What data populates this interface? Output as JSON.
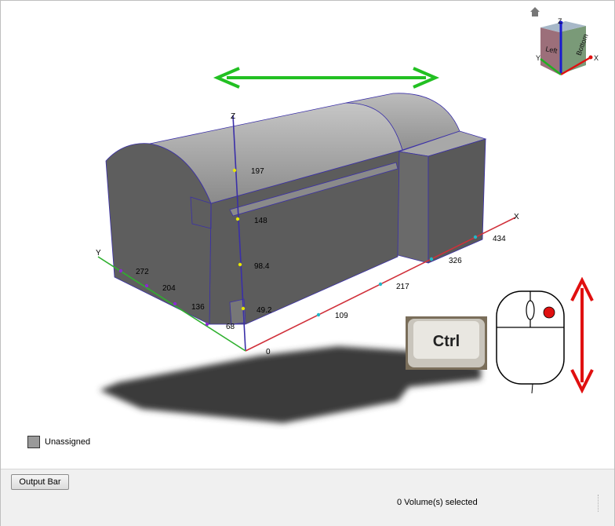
{
  "viewport": {
    "legend": {
      "label": "Unassigned"
    },
    "axes": {
      "z_label": "Z",
      "x_label": "X",
      "y_label": "Y",
      "origin_label": "0",
      "z_ticks": [
        "197",
        "148",
        "98.4",
        "49.2"
      ],
      "x_ticks": [
        "109",
        "217",
        "326",
        "434"
      ],
      "y_ticks": [
        "272",
        "204",
        "136",
        "68"
      ]
    },
    "view_cube": {
      "left_face": "Left",
      "bottom_face": "Bottom",
      "z": "Z",
      "x": "X",
      "y": "Y"
    },
    "overlay": {
      "ctrl_key_label": "Ctrl"
    },
    "colors": {
      "axis_x": "#d0303a",
      "axis_y": "#2fb02f",
      "axis_z": "#3a2fa8",
      "hint_green": "#22c022",
      "hint_red": "#e01010",
      "model": "#606060"
    }
  },
  "bottom_panel": {
    "output_bar_button": "Output Bar",
    "status_text": "0 Volume(s) selected"
  },
  "icons": [
    "home-icon",
    "view-cube-icon",
    "mouse-icon",
    "updown-arrow-icon",
    "left-right-arrow-icon",
    "ctrl-key-icon"
  ]
}
